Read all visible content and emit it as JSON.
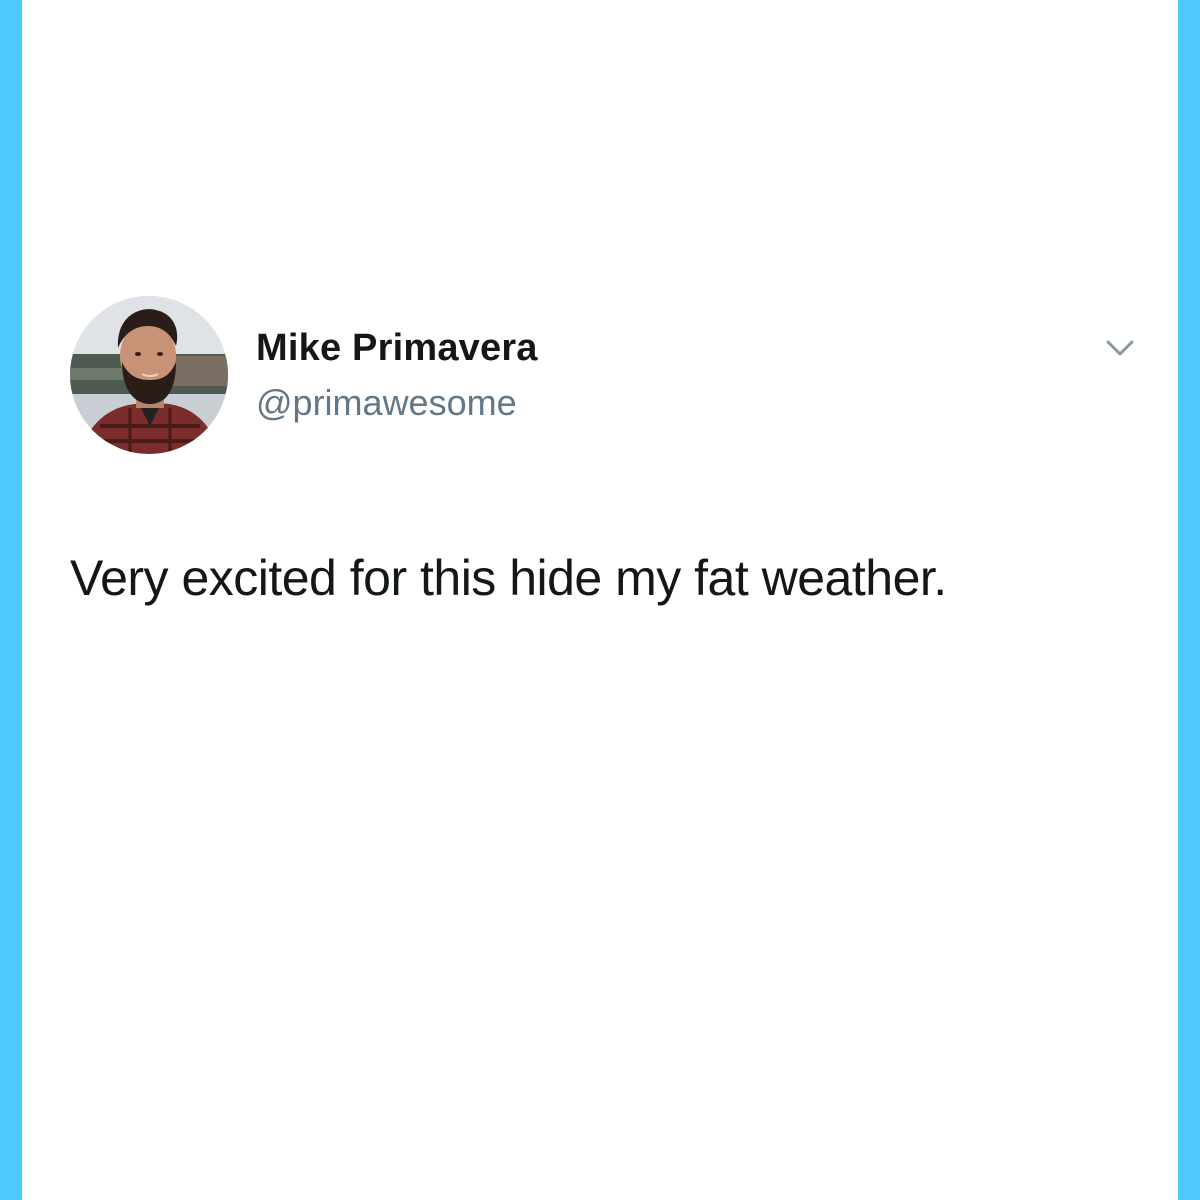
{
  "frame": {
    "border_color": "#4cc9ff"
  },
  "tweet": {
    "author": {
      "display_name": "Mike Primavera",
      "handle": "@primawesome",
      "avatar_icon": "profile-photo"
    },
    "menu_icon": "chevron-down-icon",
    "text": "Very excited for this hide my fat weather."
  }
}
